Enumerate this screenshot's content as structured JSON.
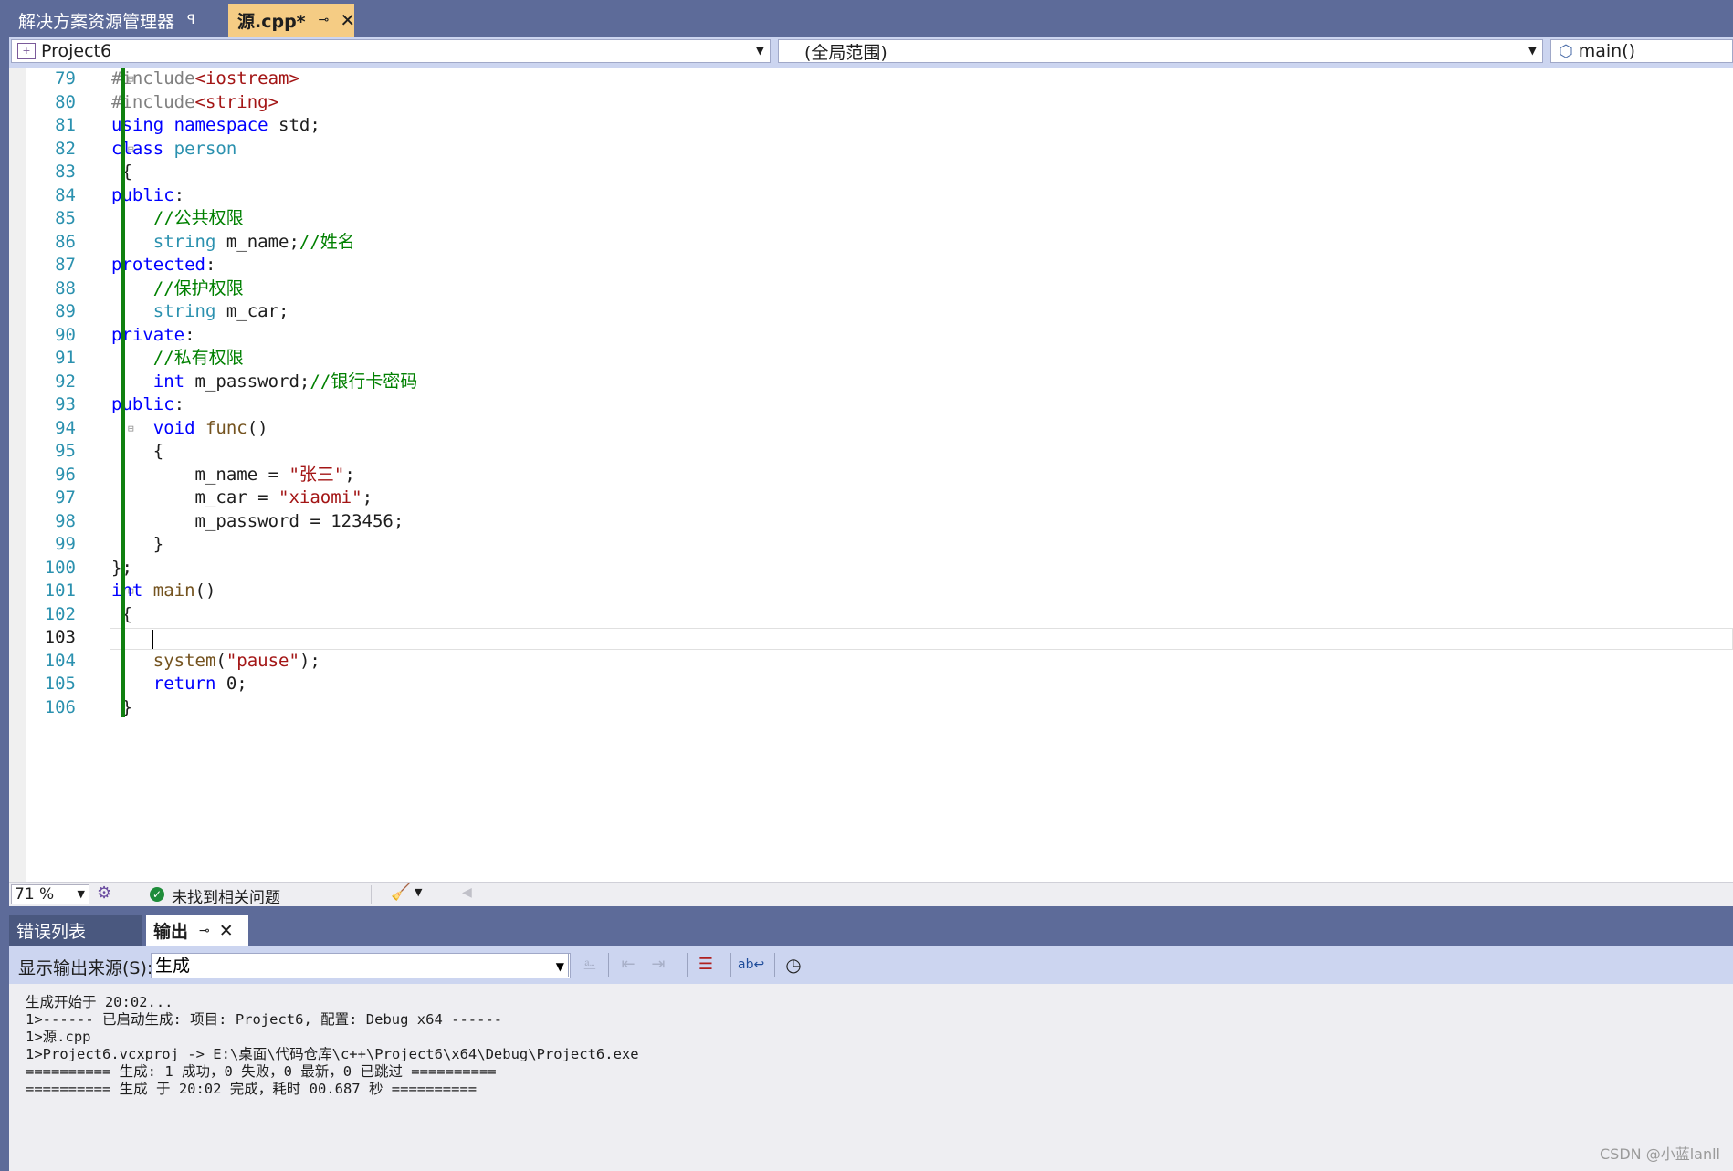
{
  "tabs": {
    "solution_explorer": "解决方案资源管理器",
    "active_file": "源.cpp*"
  },
  "navbar": {
    "project": "Project6",
    "scope": "(全局范围)",
    "member": "main()"
  },
  "editor": {
    "lines": [
      {
        "n": "79",
        "html_parts": [
          [
            "pp",
            "#include"
          ],
          [
            "st",
            "<iostream>"
          ]
        ]
      },
      {
        "n": "80",
        "html_parts": [
          [
            "pp",
            "#include"
          ],
          [
            "st",
            "<string>"
          ]
        ]
      },
      {
        "n": "81",
        "html_parts": [
          [
            "kw",
            "using"
          ],
          [
            "",
            ""
          ],
          [
            "kw",
            " namespace"
          ],
          [
            "",
            " std;"
          ]
        ]
      },
      {
        "n": "82",
        "html_parts": [
          [
            "kw",
            "class"
          ],
          [
            "ty",
            " person"
          ]
        ]
      },
      {
        "n": "83",
        "html_parts": [
          [
            "",
            " {"
          ]
        ]
      },
      {
        "n": "84",
        "html_parts": [
          [
            "kw",
            "public"
          ],
          [
            "",
            ":"
          ]
        ]
      },
      {
        "n": "85",
        "html_parts": [
          [
            "",
            "    "
          ],
          [
            "cm",
            "//公共权限"
          ]
        ]
      },
      {
        "n": "86",
        "html_parts": [
          [
            "",
            "    "
          ],
          [
            "ty",
            "string"
          ],
          [
            "",
            " m_name;"
          ],
          [
            "cm",
            "//姓名"
          ]
        ]
      },
      {
        "n": "87",
        "html_parts": [
          [
            "kw",
            "protected"
          ],
          [
            "",
            ":"
          ]
        ]
      },
      {
        "n": "88",
        "html_parts": [
          [
            "",
            "    "
          ],
          [
            "cm",
            "//保护权限"
          ]
        ]
      },
      {
        "n": "89",
        "html_parts": [
          [
            "",
            "    "
          ],
          [
            "ty",
            "string"
          ],
          [
            "",
            " m_car;"
          ]
        ]
      },
      {
        "n": "90",
        "html_parts": [
          [
            "kw",
            "private"
          ],
          [
            "",
            ":"
          ]
        ]
      },
      {
        "n": "91",
        "html_parts": [
          [
            "",
            "    "
          ],
          [
            "cm",
            "//私有权限"
          ]
        ]
      },
      {
        "n": "92",
        "html_parts": [
          [
            "",
            "    "
          ],
          [
            "kw",
            "int"
          ],
          [
            "",
            " m_password;"
          ],
          [
            "cm",
            "//银行卡密码"
          ]
        ]
      },
      {
        "n": "93",
        "html_parts": [
          [
            "kw",
            "public"
          ],
          [
            "",
            ":"
          ]
        ]
      },
      {
        "n": "94",
        "html_parts": [
          [
            "",
            "    "
          ],
          [
            "kw",
            "void"
          ],
          [
            "fn",
            " func"
          ],
          [
            "",
            "()"
          ]
        ]
      },
      {
        "n": "95",
        "html_parts": [
          [
            "",
            "    {"
          ]
        ]
      },
      {
        "n": "96",
        "html_parts": [
          [
            "",
            "        m_name "
          ],
          [
            "",
            "= "
          ],
          [
            "st",
            "\"张三\""
          ],
          [
            "",
            ";"
          ]
        ]
      },
      {
        "n": "97",
        "html_parts": [
          [
            "",
            "        m_car "
          ],
          [
            "",
            "= "
          ],
          [
            "st",
            "\"xiaomi\""
          ],
          [
            "",
            ";"
          ]
        ]
      },
      {
        "n": "98",
        "html_parts": [
          [
            "",
            "        m_password = 123456;"
          ]
        ]
      },
      {
        "n": "99",
        "html_parts": [
          [
            "",
            "    }"
          ]
        ]
      },
      {
        "n": "100",
        "html_parts": [
          [
            "",
            "};"
          ]
        ]
      },
      {
        "n": "101",
        "html_parts": [
          [
            "kw",
            "int"
          ],
          [
            "fn",
            " main"
          ],
          [
            "",
            "()"
          ]
        ]
      },
      {
        "n": "102",
        "html_parts": [
          [
            "",
            " {"
          ]
        ]
      },
      {
        "n": "103",
        "html_parts": [
          [
            "",
            ""
          ]
        ]
      },
      {
        "n": "104",
        "html_parts": [
          [
            "",
            "    "
          ],
          [
            "fn",
            "system"
          ],
          [
            "",
            "("
          ],
          [
            "st",
            "\"pause\""
          ],
          [
            "",
            ");"
          ]
        ]
      },
      {
        "n": "105",
        "html_parts": [
          [
            "",
            "    "
          ],
          [
            "kw",
            "return"
          ],
          [
            "",
            " 0;"
          ]
        ]
      },
      {
        "n": "106",
        "html_parts": [
          [
            "",
            " }"
          ]
        ]
      }
    ],
    "current_line": "103"
  },
  "edstatus": {
    "zoom": "71 %",
    "issues": "未找到相关问题"
  },
  "output_tabs": {
    "errors": "错误列表",
    "output": "输出"
  },
  "output_toolbar": {
    "source_label": "显示输出来源(S):",
    "source_value": "生成"
  },
  "output_lines": [
    "生成开始于 20:02...",
    "1>------ 已启动生成: 项目: Project6, 配置: Debug x64 ------",
    "1>源.cpp",
    "1>Project6.vcxproj -> E:\\桌面\\代码仓库\\c++\\Project6\\x64\\Debug\\Project6.exe",
    "========== 生成: 1 成功，0 失败，0 最新，0 已跳过 ==========",
    "========== 生成 于 20:02 完成，耗时 00.687 秒 =========="
  ],
  "watermark": "CSDN @小蓝lanll"
}
